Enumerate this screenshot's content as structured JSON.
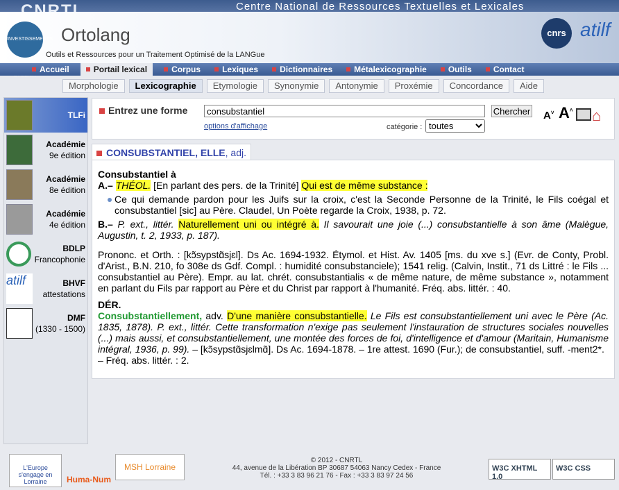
{
  "header": {
    "logo": "CNRTL",
    "title": "Centre National de Ressources Textuelles et Lexicales",
    "ortolang_name": "Ortolang",
    "ortolang_tagline": "Outils et Ressources pour un Traitement Optimisé de la LANGue",
    "investissements": "INVESTISSEMENTS D'AVENIR",
    "cnrs": "cnrs",
    "atilf": "atilf"
  },
  "mainnav": [
    {
      "label": "Accueil"
    },
    {
      "label": "Portail lexical",
      "active": true
    },
    {
      "label": "Corpus"
    },
    {
      "label": "Lexiques"
    },
    {
      "label": "Dictionnaires"
    },
    {
      "label": "Métalexicographie"
    },
    {
      "label": "Outils"
    },
    {
      "label": "Contact"
    }
  ],
  "subtabs": [
    {
      "label": "Morphologie"
    },
    {
      "label": "Lexicographie",
      "active": true
    },
    {
      "label": "Etymologie"
    },
    {
      "label": "Synonymie"
    },
    {
      "label": "Antonymie"
    },
    {
      "label": "Proxémie"
    },
    {
      "label": "Concordance"
    },
    {
      "label": "Aide"
    }
  ],
  "sidebar": [
    {
      "line1": "TLFi",
      "line2": "",
      "active": true
    },
    {
      "line1": "Académie",
      "line2": "9e édition"
    },
    {
      "line1": "Académie",
      "line2": "8e édition"
    },
    {
      "line1": "Académie",
      "line2": "4e édition"
    },
    {
      "line1": "BDLP",
      "line2": "Francophonie"
    },
    {
      "line1": "BHVF",
      "line2": "attestations"
    },
    {
      "line1": "DMF",
      "line2": "(1330 - 1500)"
    }
  ],
  "search": {
    "label": "Entrez une forme",
    "value": "consubstantiel",
    "button": "Chercher",
    "options_link": "options d'affichage",
    "category_label": "catégorie :",
    "category_value": "toutes"
  },
  "entry": {
    "headword": "CONSUBSTANTIEL, ELLE",
    "pos": ", adj.",
    "p1_title": "Consubstantiel à",
    "p1_a": "A.–",
    "p1_a_domain": "THÉOL.",
    "p1_a_text": "[En parlant des pers. de la Trinité]",
    "p1_a_def": "Qui est de même substance :",
    "bullet_text": "Ce qui demande pardon pour les Juifs sur la croix, c'est la Seconde Personne de la Trinité, le Fils coégal et consubstantiel [sic] au Père. Claudel, Un Poète regarde la Croix, 1938, p. 72.",
    "b_label": "B.–",
    "b_domain": "P. ext., littér.",
    "b_def": "Naturellement uni ou intégré à.",
    "b_example": "Il savourait une joie (...) consubstantielle à son âme (Malègue, Augustin, t. 2, 1933, p. 187).",
    "prononc": "Prononc. et Orth. : [kɔ̃sypstɑ̃sjɛl]. Ds Ac. 1694-1932. Étymol. et Hist. Av. 1405 [ms. du xve s.] (Evr. de Conty, Probl. d'Arist., B.N. 210, fo 308e ds Gdf. Compl. : humidité consubstanciele); 1541 relig. (Calvin, Instit., 71 ds Littré : le Fils ... consubstantiel au Père). Empr. au lat. chrét. consubstantialis « de même nature, de même substance », notamment en parlant du Fils par rapport au Père et du Christ par rapport à l'humanité. Fréq. abs. littér. : 40.",
    "der_title": "DÉR.",
    "der_word": "Consubstantiellement,",
    "der_pos": "adv.",
    "der_def": "D'une manière consubstantielle.",
    "der_example": "Le Fils est consubstantiellement uni avec le Père (Ac. 1835, 1878). P. ext., littér. Cette transformation n'exige pas seulement l'instauration de structures sociales nouvelles (...) mais aussi, et consubstantiellement, une montée des forces de foi, d'intelligence et d'amour (Maritain, Humanisme intégral, 1936, p. 99).",
    "der_prononc": "– [kɔ̃sypstɑ̃sjɛlmɑ̃]. Ds Ac. 1694-1878. – 1re attest. 1690 (Fur.); de consubstantiel, suff. -ment2*.",
    "der_freq": "– Fréq. abs. littér. : 2."
  },
  "footer": {
    "copyright": "© 2012 - CNRTL",
    "address": "44, avenue de la Libération BP 30687 54063 Nancy Cedex - France",
    "phone": "Tél. : +33 3 83 96 21 76 - Fax : +33 3 83 97 24 56",
    "logo1": "L'Europe s'engage en Lorraine",
    "logo2": "Huma-Num",
    "logo3": "MSH Lorraine",
    "w3c_xhtml": "W3C XHTML 1.0",
    "w3c_css": "W3C CSS"
  }
}
